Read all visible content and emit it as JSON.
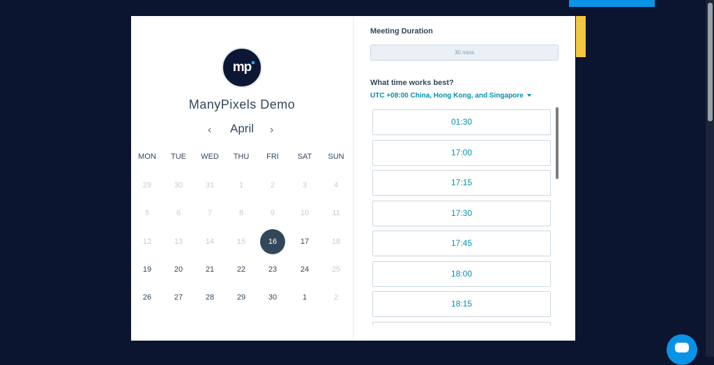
{
  "colors": {
    "background": "#0b1530",
    "accent_blue": "#0a93e6",
    "accent_yellow": "#f5c842",
    "text_dark": "#33475b",
    "link": "#0091ae",
    "selected_day": "#33475b"
  },
  "brand": {
    "logo_text": "mp",
    "name": "ManyPixels Demo"
  },
  "calendar": {
    "month": "April",
    "prev_icon": "‹",
    "next_icon": "›",
    "weekdays": [
      "MON",
      "TUE",
      "WED",
      "THU",
      "FRI",
      "SAT",
      "SUN"
    ],
    "weeks": [
      [
        {
          "d": "29",
          "muted": true
        },
        {
          "d": "30",
          "muted": true
        },
        {
          "d": "31",
          "muted": true
        },
        {
          "d": "1",
          "muted": true
        },
        {
          "d": "2",
          "muted": true
        },
        {
          "d": "3",
          "muted": true
        },
        {
          "d": "4",
          "muted": true
        }
      ],
      [
        {
          "d": "5",
          "muted": true
        },
        {
          "d": "6",
          "muted": true
        },
        {
          "d": "7",
          "muted": true
        },
        {
          "d": "8",
          "muted": true
        },
        {
          "d": "9",
          "muted": true
        },
        {
          "d": "10",
          "muted": true
        },
        {
          "d": "11",
          "muted": true
        }
      ],
      [
        {
          "d": "12",
          "muted": true
        },
        {
          "d": "13",
          "muted": true
        },
        {
          "d": "14",
          "muted": true
        },
        {
          "d": "15",
          "muted": true
        },
        {
          "d": "16",
          "selected": true
        },
        {
          "d": "17"
        },
        {
          "d": "18",
          "muted": true
        }
      ],
      [
        {
          "d": "19"
        },
        {
          "d": "20"
        },
        {
          "d": "21"
        },
        {
          "d": "22"
        },
        {
          "d": "23"
        },
        {
          "d": "24"
        },
        {
          "d": "25",
          "muted": true
        }
      ],
      [
        {
          "d": "26"
        },
        {
          "d": "27"
        },
        {
          "d": "28"
        },
        {
          "d": "29"
        },
        {
          "d": "30"
        },
        {
          "d": "1"
        },
        {
          "d": "2",
          "muted": true
        }
      ]
    ]
  },
  "duration": {
    "label": "Meeting Duration",
    "value": "30 mins"
  },
  "times": {
    "label": "What time works best?",
    "timezone": "UTC +08:00 China, Hong Kong, and Singapore",
    "slots": [
      "01:30",
      "17:00",
      "17:15",
      "17:30",
      "17:45",
      "18:00",
      "18:15",
      ""
    ]
  }
}
